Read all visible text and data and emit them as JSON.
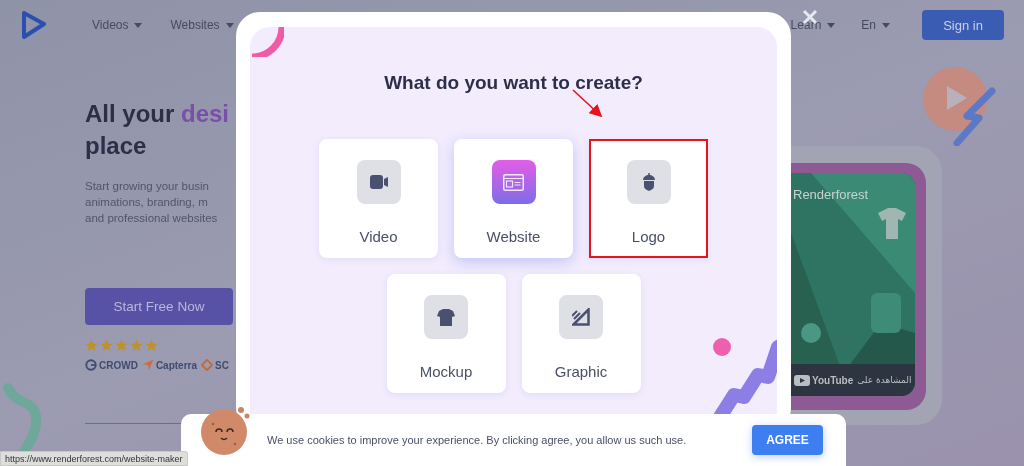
{
  "header": {
    "nav_left": [
      "Videos",
      "Websites"
    ],
    "nav_right": [
      "Learn",
      "En"
    ],
    "sign_in": "Sign in"
  },
  "hero": {
    "title_parts": [
      {
        "text": "All your",
        "highlight": false
      },
      {
        "text": "desi",
        "highlight": true
      }
    ],
    "title_line_2": "place",
    "description_lines": [
      "Start growing your busin",
      "animations, branding, m",
      "and professional websites"
    ],
    "cta": "Start Free Now",
    "stars": 5,
    "review_logos": [
      "CROWD",
      "Capterra",
      "SC"
    ]
  },
  "video": {
    "title": "Renderforest",
    "platform": "YouTube",
    "watch_on": "المشاهدة على"
  },
  "modal": {
    "title": "What do you want to create?",
    "options": [
      {
        "label": "Video",
        "kind": "video",
        "selected": false,
        "highlighted": false
      },
      {
        "label": "Website",
        "kind": "website",
        "selected": true,
        "highlighted": false
      },
      {
        "label": "Logo",
        "kind": "logo",
        "selected": false,
        "highlighted": true
      },
      {
        "label": "Mockup",
        "kind": "mockup",
        "selected": false,
        "highlighted": false
      },
      {
        "label": "Graphic",
        "kind": "graphic",
        "selected": false,
        "highlighted": false
      }
    ]
  },
  "cookie": {
    "message": "We use cookies to improve your experience. By clicking agree, you allow us such use.",
    "button": "AGREE"
  },
  "status_url": "https://www.renderforest.com/website-maker"
}
